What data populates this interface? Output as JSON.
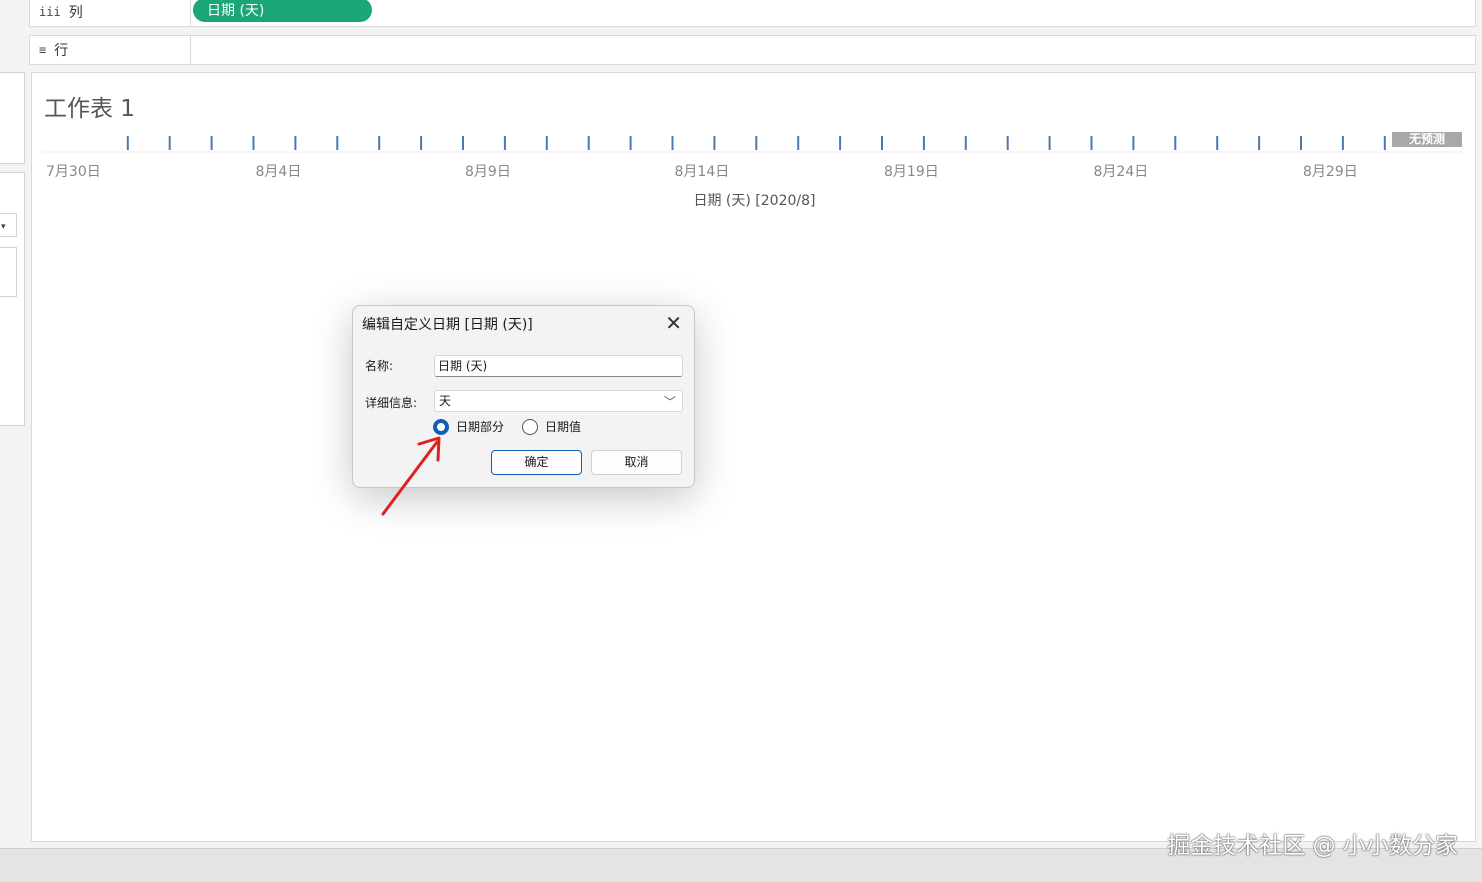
{
  "shelves": {
    "columns": {
      "icon": "iii",
      "label": "列",
      "pill": "日期 (天)"
    },
    "rows": {
      "icon": "≡",
      "label": "行"
    }
  },
  "sheet": {
    "title": "工作表 1",
    "badge": "无预测",
    "chart_data": {
      "type": "scatter",
      "x": [
        "2020-07-30",
        "2020-07-31",
        "2020-08-01",
        "2020-08-02",
        "2020-08-03",
        "2020-08-04",
        "2020-08-05",
        "2020-08-06",
        "2020-08-07",
        "2020-08-08",
        "2020-08-09",
        "2020-08-10",
        "2020-08-11",
        "2020-08-12",
        "2020-08-13",
        "2020-08-14",
        "2020-08-15",
        "2020-08-16",
        "2020-08-17",
        "2020-08-18",
        "2020-08-19",
        "2020-08-20",
        "2020-08-21",
        "2020-08-22",
        "2020-08-23",
        "2020-08-24",
        "2020-08-25",
        "2020-08-26",
        "2020-08-27",
        "2020-08-28",
        "2020-08-29",
        "2020-08-30",
        "2020-08-31",
        "2020-09-01"
      ],
      "marks": [
        "2020-08-01",
        "2020-08-02",
        "2020-08-03",
        "2020-08-04",
        "2020-08-05",
        "2020-08-06",
        "2020-08-07",
        "2020-08-08",
        "2020-08-09",
        "2020-08-10",
        "2020-08-11",
        "2020-08-12",
        "2020-08-13",
        "2020-08-14",
        "2020-08-15",
        "2020-08-16",
        "2020-08-17",
        "2020-08-18",
        "2020-08-19",
        "2020-08-20",
        "2020-08-21",
        "2020-08-22",
        "2020-08-23",
        "2020-08-24",
        "2020-08-25",
        "2020-08-26",
        "2020-08-27",
        "2020-08-28",
        "2020-08-29",
        "2020-08-30",
        "2020-08-31"
      ],
      "tick_labels": [
        "7月30日",
        "8月4日",
        "8月9日",
        "8月14日",
        "8月19日",
        "8月24日",
        "8月29日"
      ],
      "tick_dates": [
        "2020-07-30",
        "2020-08-04",
        "2020-08-09",
        "2020-08-14",
        "2020-08-19",
        "2020-08-24",
        "2020-08-29"
      ],
      "xlabel": "日期 (天) [2020/8]",
      "mark_color": "#4e79a7"
    }
  },
  "dialog": {
    "title": "编辑自定义日期 [日期 (天)]",
    "name_label": "名称:",
    "name_value": "日期 (天)",
    "detail_label": "详细信息:",
    "detail_value": "天",
    "radio_date_part": "日期部分",
    "radio_date_value": "日期值",
    "selected": "date_part",
    "ok": "确定",
    "cancel": "取消"
  },
  "watermark": "掘金技术社区 @ 小小数分家"
}
